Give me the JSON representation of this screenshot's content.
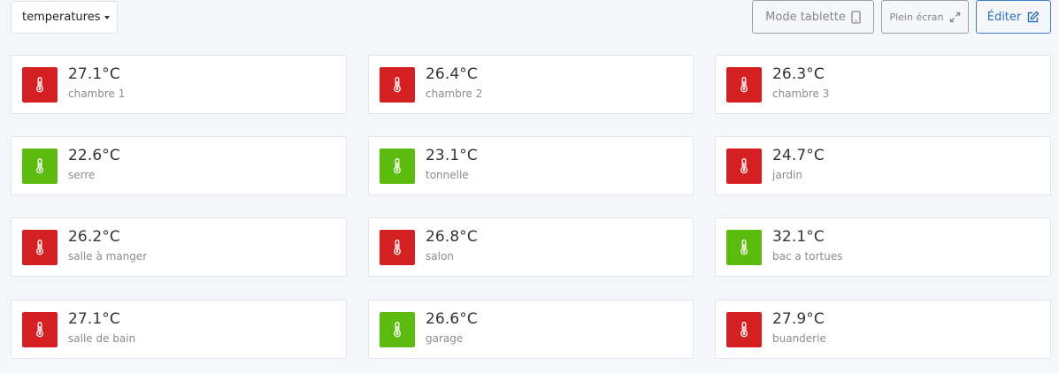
{
  "toolbar": {
    "dropdown_label": "temperatures",
    "tablet_label": "Mode tablette",
    "tablet_icon": "tablet-icon",
    "fullscreen_label": "Plein écran",
    "fullscreen_icon": "expand-icon",
    "edit_label": "Éditer",
    "edit_icon": "edit-icon"
  },
  "colors": {
    "hot": "#d42023",
    "ok": "#5cbb0f",
    "accent": "#2f6fb7"
  },
  "sensors": [
    {
      "value": "27.1°C",
      "label": "chambre 1",
      "status": "hot",
      "icon": "thermometer-icon"
    },
    {
      "value": "26.4°C",
      "label": "chambre 2",
      "status": "hot",
      "icon": "thermometer-icon"
    },
    {
      "value": "26.3°C",
      "label": "chambre 3",
      "status": "hot",
      "icon": "thermometer-icon"
    },
    {
      "value": "22.6°C",
      "label": "serre",
      "status": "ok",
      "icon": "thermometer-icon"
    },
    {
      "value": "23.1°C",
      "label": "tonnelle",
      "status": "ok",
      "icon": "thermometer-icon"
    },
    {
      "value": "24.7°C",
      "label": "jardin",
      "status": "hot",
      "icon": "thermometer-icon"
    },
    {
      "value": "26.2°C",
      "label": "salle à manger",
      "status": "hot",
      "icon": "thermometer-icon"
    },
    {
      "value": "26.8°C",
      "label": "salon",
      "status": "hot",
      "icon": "thermometer-icon"
    },
    {
      "value": "32.1°C",
      "label": "bac a tortues",
      "status": "ok",
      "icon": "thermometer-icon"
    },
    {
      "value": "27.1°C",
      "label": "salle de bain",
      "status": "hot",
      "icon": "thermometer-icon"
    },
    {
      "value": "26.6°C",
      "label": "garage",
      "status": "ok",
      "icon": "thermometer-icon"
    },
    {
      "value": "27.9°C",
      "label": "buanderie",
      "status": "hot",
      "icon": "thermometer-icon"
    }
  ]
}
